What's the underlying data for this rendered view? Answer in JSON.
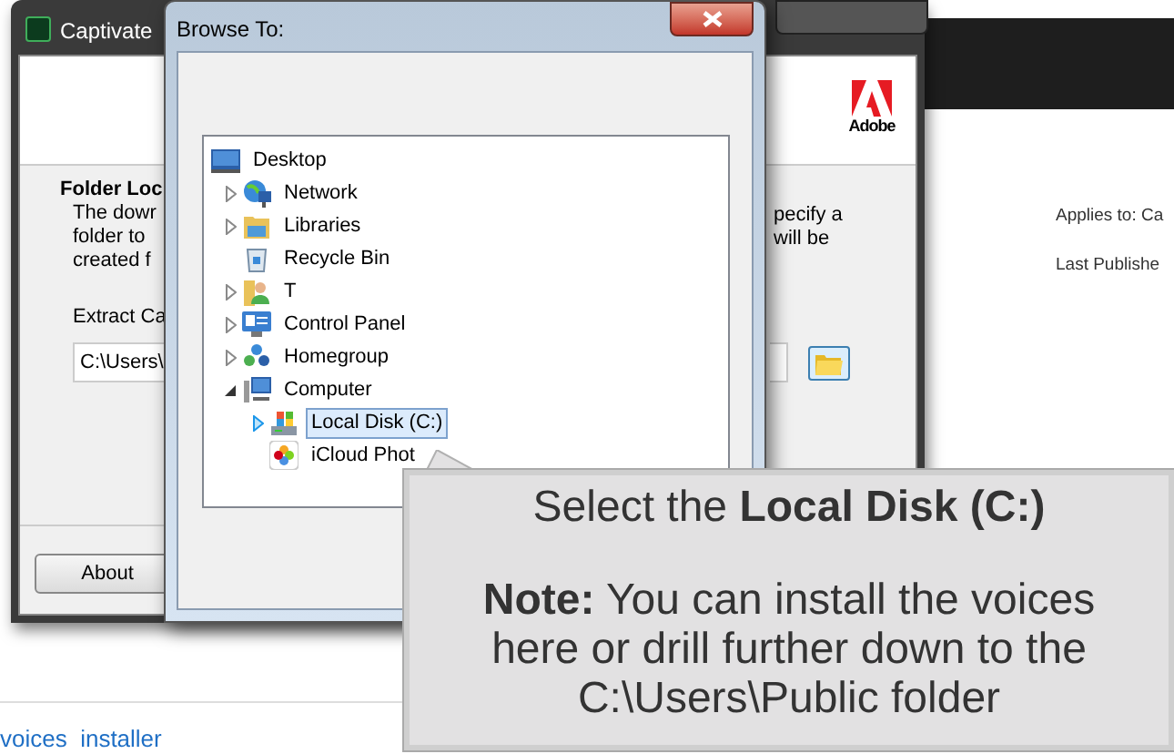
{
  "background_page": {
    "applies_to": "Applies to: Ca",
    "last_published": "Last Publishe",
    "link": "voices  installer"
  },
  "captivate_window": {
    "title": "Captivate",
    "logo_text": "Adobe",
    "section_title": "Folder Loc",
    "description_left": [
      "The dowr",
      "folder to",
      "created f"
    ],
    "description_right": [
      "pecify a",
      "will be"
    ],
    "extract_label": "Extract Ca",
    "path_value": "C:\\Users\\",
    "about_button": "About"
  },
  "browse_dialog": {
    "title": "Browse To:",
    "tree": [
      {
        "label": "Desktop",
        "kind": "desktop",
        "arrow": false,
        "selected": false,
        "children": [
          {
            "label": "Network",
            "kind": "network",
            "arrow": true,
            "expanded": false,
            "selected": false
          },
          {
            "label": "Libraries",
            "kind": "library",
            "arrow": true,
            "expanded": false,
            "selected": false
          },
          {
            "label": "Recycle Bin",
            "kind": "recycle",
            "arrow": false,
            "selected": false
          },
          {
            "label": "T",
            "kind": "user",
            "arrow": true,
            "expanded": false,
            "selected": false
          },
          {
            "label": "Control Panel",
            "kind": "control",
            "arrow": true,
            "expanded": false,
            "selected": false
          },
          {
            "label": "Homegroup",
            "kind": "homegroup",
            "arrow": true,
            "expanded": false,
            "selected": false
          },
          {
            "label": "Computer",
            "kind": "computer",
            "arrow": true,
            "expanded": true,
            "selected": false,
            "children": [
              {
                "label": "Local Disk (C:)",
                "kind": "disk",
                "arrow": true,
                "expanded": false,
                "selected": true
              },
              {
                "label": "iCloud Phot",
                "kind": "photos",
                "arrow": false,
                "selected": false
              }
            ]
          }
        ]
      }
    ]
  },
  "callout": {
    "title": "Select the **Local Disk (C:)**",
    "note": "**Note:** You can install the voices here or drill further down to the C:\\Users\\Public folder"
  }
}
